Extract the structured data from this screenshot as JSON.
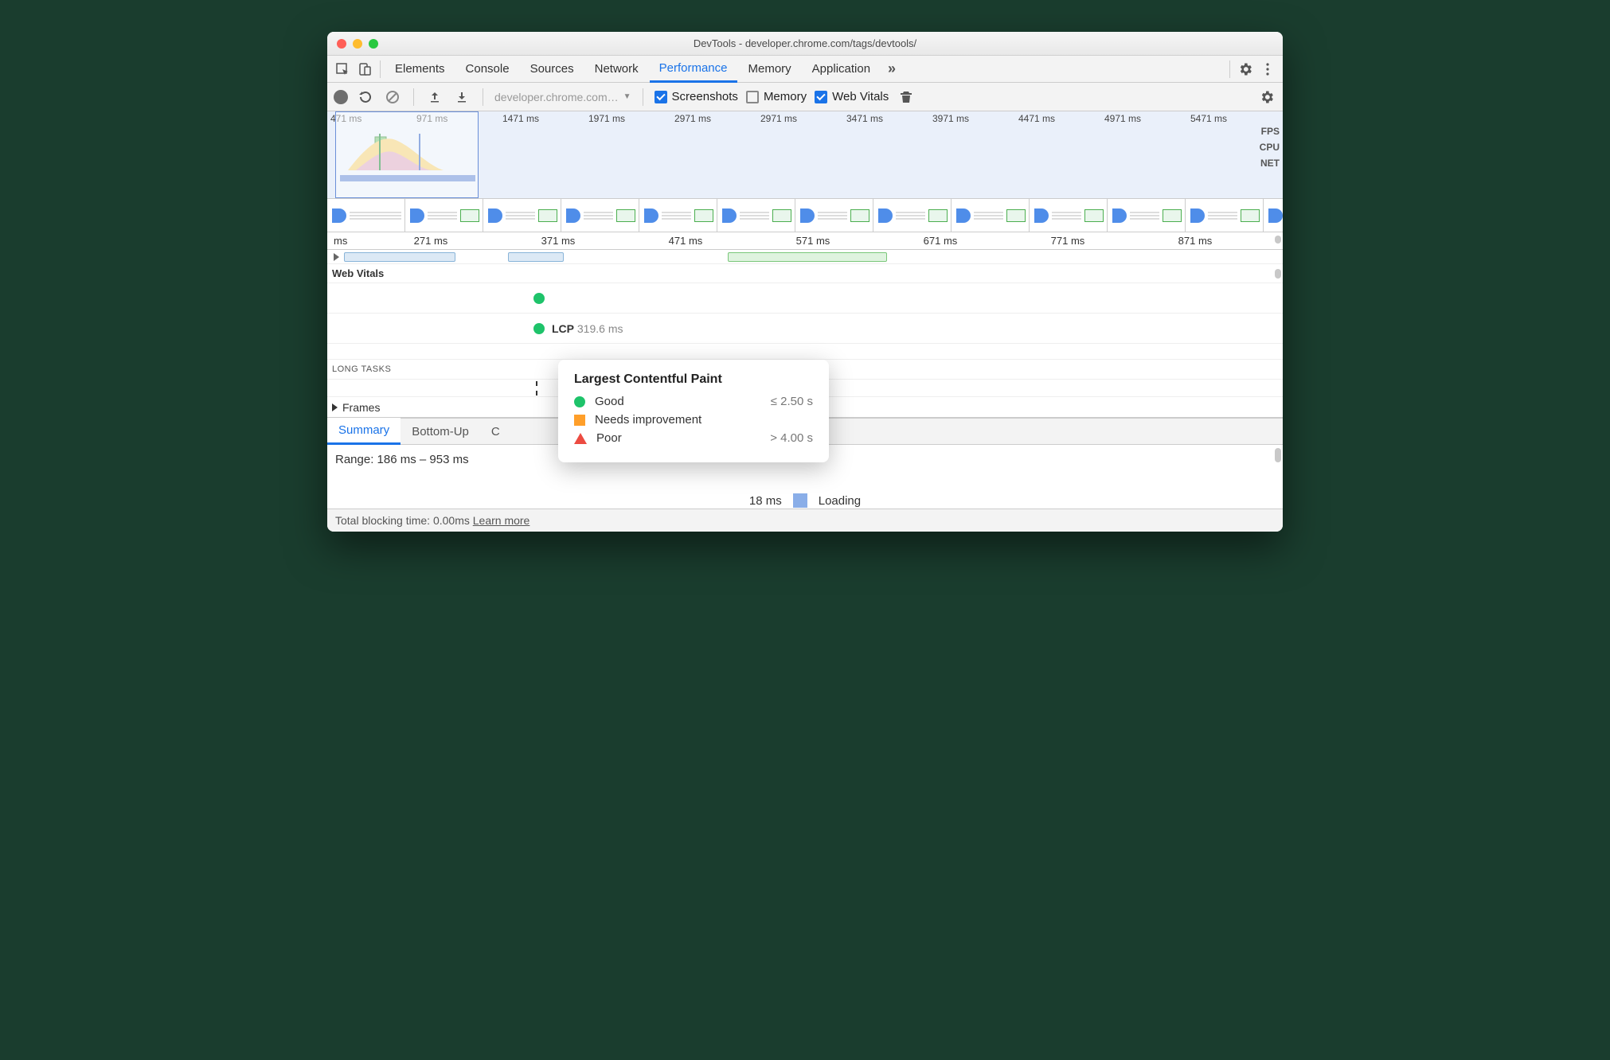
{
  "window": {
    "title": "DevTools - developer.chrome.com/tags/devtools/"
  },
  "tabs": {
    "items": [
      "Elements",
      "Console",
      "Sources",
      "Network",
      "Performance",
      "Memory",
      "Application"
    ],
    "active": 4
  },
  "perfToolbar": {
    "source": "developer.chrome.com…",
    "screenshots_label": "Screenshots",
    "memory_label": "Memory",
    "webvitals_label": "Web Vitals"
  },
  "overview": {
    "ticks": [
      "471 ms",
      "971 ms",
      "1471 ms",
      "1971 ms",
      "2971 ms",
      "2971 ms",
      "3471 ms",
      "3971 ms",
      "4471 ms",
      "4971 ms",
      "5471 ms"
    ],
    "lane_labels": [
      "FPS",
      "CPU",
      "NET"
    ]
  },
  "detailRuler": {
    "first": "ms",
    "ticks": [
      "271 ms",
      "371 ms",
      "471 ms",
      "571 ms",
      "671 ms",
      "771 ms",
      "871 ms"
    ]
  },
  "webVitals": {
    "header": "Web Vitals",
    "lcp_label": "LCP",
    "lcp_value": "319.6 ms",
    "long_tasks_label": "LONG TASKS",
    "frames_label": "Frames"
  },
  "tooltip": {
    "title": "Largest Contentful Paint",
    "rows": [
      {
        "label": "Good",
        "value": "≤ 2.50 s"
      },
      {
        "label": "Needs improvement",
        "value": ""
      },
      {
        "label": "Poor",
        "value": "> 4.00 s"
      }
    ]
  },
  "bottomTabs": {
    "items": [
      "Summary",
      "Bottom-Up",
      "C"
    ],
    "active": 0
  },
  "summary": {
    "range": "Range: 186 ms – 953 ms",
    "legend_value": "18 ms",
    "legend_label": "Loading"
  },
  "footer": {
    "text": "Total blocking time: 0.00ms",
    "link": "Learn more"
  }
}
